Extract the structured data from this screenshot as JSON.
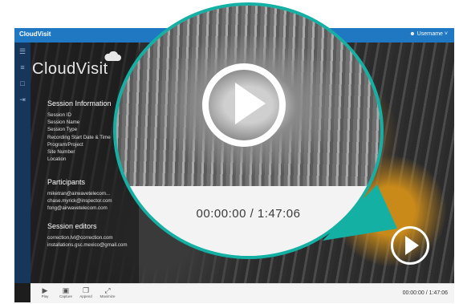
{
  "app": {
    "logo": "CloudVisit",
    "brand": "CloudVisit",
    "username": "Username"
  },
  "sidebar": {
    "items": [
      {
        "icon": "list-icon"
      },
      {
        "icon": "menu-icon"
      },
      {
        "icon": "folder-icon"
      },
      {
        "icon": "logout-icon"
      }
    ]
  },
  "session_info": {
    "title": "Session Information",
    "fields": [
      "Session ID",
      "Session Name",
      "Session Type",
      "Recording Start Date & Time",
      "Program/Project",
      "Site Number",
      "Location"
    ]
  },
  "participants": {
    "title": "Participants",
    "items": [
      "miketran@airwavetelecom...",
      "chase.myrick@inspector.com",
      "fong@airwavetelecom.com"
    ]
  },
  "session_editors": {
    "title": "Session editors",
    "items": [
      "correction.lvl@correction.com",
      "installations.gsc.mexico@gmail.com"
    ]
  },
  "player": {
    "timecode": "00:00:00 / 1:47:06",
    "timecode_small": "00:00:00 / 1:47:06"
  },
  "controls": [
    {
      "label": "Play",
      "icon": "play-icon"
    },
    {
      "label": "Capture",
      "icon": "capture-icon"
    },
    {
      "label": "Append",
      "icon": "append-icon"
    },
    {
      "label": "Maximize",
      "icon": "maximize-icon"
    }
  ],
  "colors": {
    "topbar": "#1f78c1",
    "sidebar": "#16365a",
    "accent_teal": "#14b0a4"
  }
}
